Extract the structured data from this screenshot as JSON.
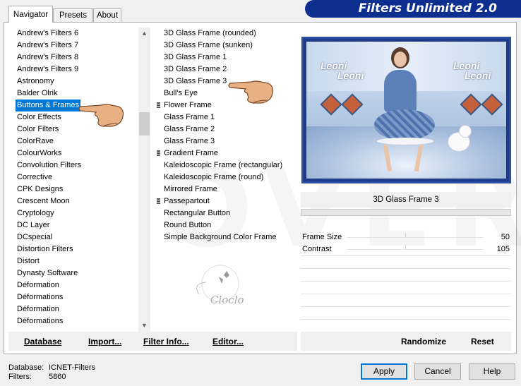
{
  "title": "Filters Unlimited 2.0",
  "tabs": [
    {
      "label": "Navigator"
    },
    {
      "label": "Presets"
    },
    {
      "label": "About"
    }
  ],
  "categories": [
    "Andrew's Filters 6",
    "Andrew's Filters 7",
    "Andrew's Filters 8",
    "Andrew's Filters 9",
    "Astronomy",
    "Balder Olrik",
    "Buttons & Frames",
    "Color Effects",
    "Color Filters",
    "ColorRave",
    "ColourWorks",
    "Convolution Filters",
    "Corrective",
    "CPK Designs",
    "Crescent Moon",
    "Cryptology",
    "DC Layer",
    "DCspecial",
    "Distortion Filters",
    "Distort",
    "Dynasty Software",
    "Déformation",
    "Déformations",
    "Déformation",
    "Déformations"
  ],
  "selected_category": "Buttons & Frames",
  "filters": [
    {
      "label": "3D Glass Frame (rounded)",
      "marked": false
    },
    {
      "label": "3D Glass Frame (sunken)",
      "marked": false
    },
    {
      "label": "3D Glass Frame 1",
      "marked": false
    },
    {
      "label": "3D Glass Frame 2",
      "marked": false
    },
    {
      "label": "3D Glass Frame 3",
      "marked": false
    },
    {
      "label": "Bull's Eye",
      "marked": false
    },
    {
      "label": "Flower Frame",
      "marked": true
    },
    {
      "label": "Glass Frame 1",
      "marked": false
    },
    {
      "label": "Glass Frame 2",
      "marked": false
    },
    {
      "label": "Glass Frame 3",
      "marked": false
    },
    {
      "label": "Gradient Frame",
      "marked": true
    },
    {
      "label": "Kaleidoscopic Frame (rectangular)",
      "marked": false
    },
    {
      "label": "Kaleidoscopic Frame (round)",
      "marked": false
    },
    {
      "label": "Mirrored Frame",
      "marked": false
    },
    {
      "label": "Passepartout",
      "marked": true
    },
    {
      "label": "Rectangular Button",
      "marked": false
    },
    {
      "label": "Round Button",
      "marked": false
    },
    {
      "label": "Simple Background Color Frame",
      "marked": false
    }
  ],
  "toolbar": {
    "database": "Database",
    "import": "Import...",
    "filter_info": "Filter Info...",
    "editor": "Editor...",
    "randomize": "Randomize",
    "reset": "Reset"
  },
  "preview": {
    "watermark_text": "Leoni",
    "logo_text": "Cloclo"
  },
  "current_filter": "3D Glass Frame 3",
  "params": [
    {
      "name": "Frame Size",
      "value": "50"
    },
    {
      "name": "Contrast",
      "value": "105"
    }
  ],
  "status": {
    "database_label": "Database:",
    "database_value": "ICNET-Filters",
    "filters_label": "Filters:",
    "filters_value": "5860"
  },
  "buttons": {
    "apply": "Apply",
    "cancel": "Cancel",
    "help": "Help"
  },
  "colors": {
    "banner": "#0d2f8f",
    "selection": "#0078d7"
  }
}
